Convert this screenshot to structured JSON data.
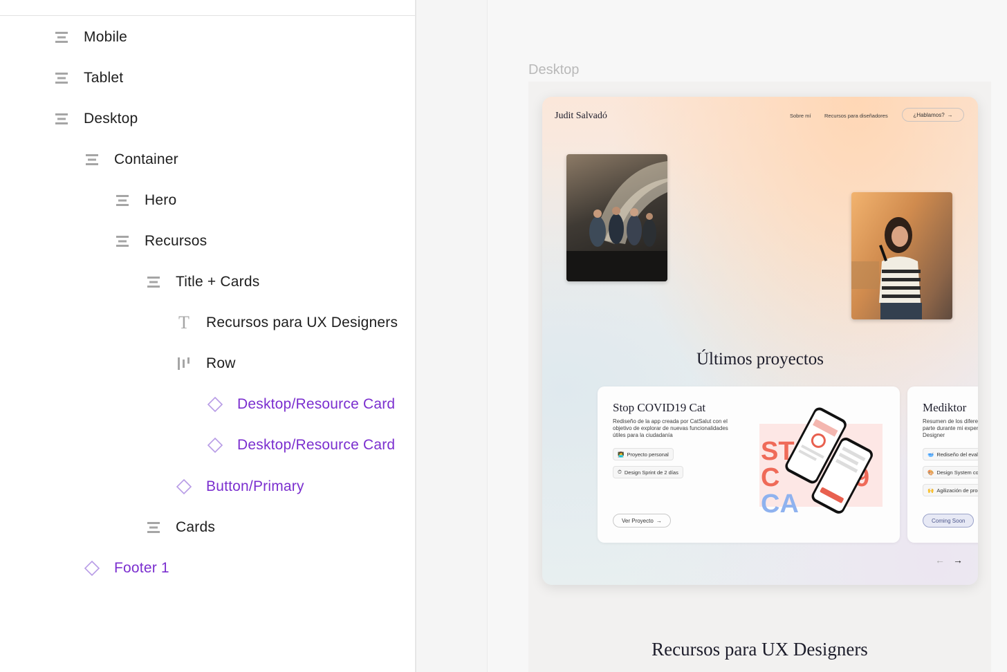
{
  "layers": [
    {
      "label": "Mobile",
      "icon": "frame-icon",
      "component": false
    },
    {
      "label": "Tablet",
      "icon": "frame-icon",
      "component": false
    },
    {
      "label": "Desktop",
      "icon": "frame-icon",
      "component": false
    },
    {
      "label": "Container",
      "icon": "frame-icon",
      "component": false
    },
    {
      "label": "Hero",
      "icon": "frame-icon",
      "component": false
    },
    {
      "label": "Recursos",
      "icon": "frame-icon",
      "component": false
    },
    {
      "label": "Title + Cards",
      "icon": "frame-icon",
      "component": false
    },
    {
      "label": "Recursos para UX Designers",
      "icon": "text-icon",
      "component": false
    },
    {
      "label": "Row",
      "icon": "horizontal-layout-icon",
      "component": false
    },
    {
      "label": "Desktop/Resource Card",
      "icon": "component-instance-icon",
      "component": true
    },
    {
      "label": "Desktop/Resource Card",
      "icon": "component-instance-icon",
      "component": true
    },
    {
      "label": "Button/Primary",
      "icon": "component-instance-icon",
      "component": true
    },
    {
      "label": "Cards",
      "icon": "frame-icon",
      "component": false
    },
    {
      "label": "Footer 1",
      "icon": "component-instance-icon",
      "component": true
    }
  ],
  "layer_text_glyph": "T",
  "canvas": {
    "frame_label": "Desktop"
  },
  "site": {
    "brand": "Judit Salvadó",
    "nav": {
      "about": "Sobre mí",
      "resources": "Recursos para diseñadores",
      "cta": "¿Hablamos?",
      "cta_arrow": "→"
    },
    "section_title": "Últimos proyectos",
    "projects": [
      {
        "title": "Stop COVID19 Cat",
        "description": "Rediseño de la app creada por CatSalut con el objetivo de explorar de nuevas funcionalidades útiles para la ciudadanía",
        "tags": [
          {
            "emoji": "👩‍💻",
            "text": "Proyecto personal"
          },
          {
            "emoji": "⏱",
            "text": "Design Sprint de 2 días"
          }
        ],
        "button": "Ver Proyecto",
        "button_arrow": "→"
      },
      {
        "title": "Mediktor",
        "description": "Resumen de los diferentes proyectos en los que formé parte durante mi experiencia en Mediktor como Product Designer",
        "tags": [
          {
            "emoji": "🥣",
            "text": "Rediseño del evaluador"
          },
          {
            "emoji": "🎨",
            "text": "Design System con Figma"
          },
          {
            "emoji": "🙌",
            "text": "Agilización de procesos"
          }
        ],
        "button": "Coming Soon"
      }
    ],
    "carousel": {
      "prev": "←",
      "next": "→"
    },
    "resources_title": "Recursos para UX Designers"
  },
  "colors": {
    "component_purple": "#7b2fcf",
    "icon_gray": "#a5a5a5",
    "ink": "#1d1d2b"
  }
}
